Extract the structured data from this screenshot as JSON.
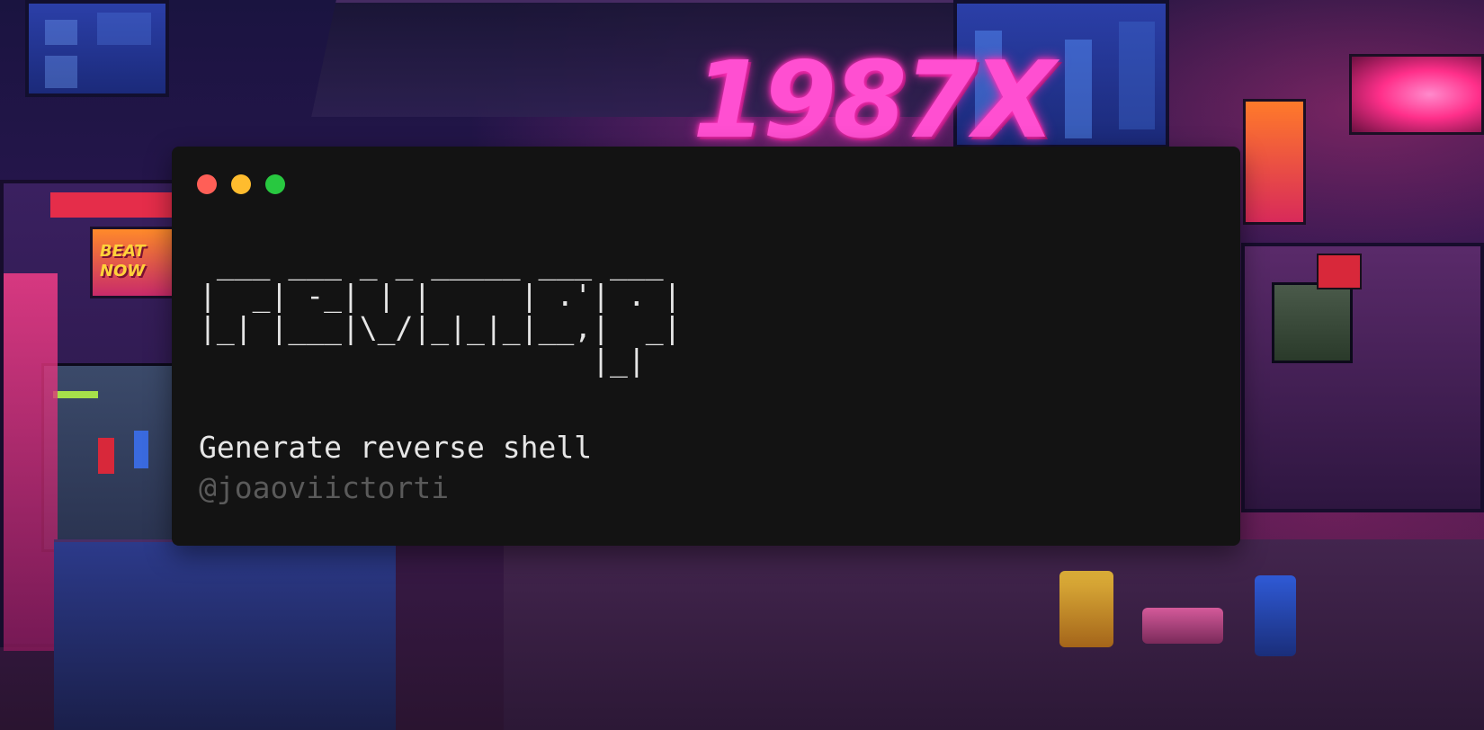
{
  "background": {
    "neon_sign_text": "1987X",
    "arcade_marquee_text": "BEAT NOW"
  },
  "terminal": {
    "window_controls": {
      "close_color": "#ff5f57",
      "minimize_color": "#febc2e",
      "maximize_color": "#28c840"
    },
    "ascii_banner": " ___ ___ _ _ _____ ___ ___\n|  _| -_| | |     | .'| . |\n|_| |___|\\_/|_|_|_|__,|  _|\n                      |_|",
    "title": "Generate reverse shell",
    "author": "@joaoviictorti"
  },
  "colors": {
    "terminal_bg": "#131313",
    "text": "#e6e6e6",
    "muted_text": "#5a5a5a",
    "neon_pink": "#ff4fd1"
  }
}
